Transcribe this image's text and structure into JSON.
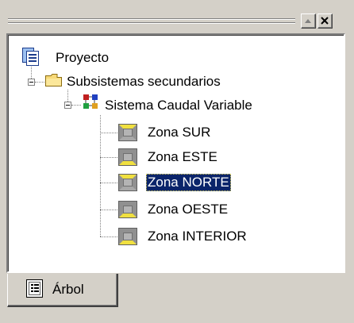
{
  "window": {
    "controls": [
      {
        "name": "scroll-up-arrow-icon"
      },
      {
        "name": "close-icon"
      }
    ]
  },
  "tree": {
    "root": {
      "label": "Proyecto",
      "icon": "project-icon"
    },
    "group": {
      "label": "Subsistemas secundarios",
      "icon": "folder-icon",
      "expanded": true
    },
    "system": {
      "label": "Sistema Caudal Variable",
      "icon": "system-icon",
      "expanded": true
    },
    "zones": [
      {
        "label": "Zona SUR",
        "icon": "zone-icon",
        "selected": false
      },
      {
        "label": "Zona ESTE",
        "icon": "zone-icon",
        "selected": false
      },
      {
        "label": "Zona NORTE",
        "icon": "zone-icon",
        "selected": true
      },
      {
        "label": "Zona OESTE",
        "icon": "zone-icon",
        "selected": false
      },
      {
        "label": "Zona INTERIOR",
        "icon": "zone-icon",
        "selected": false
      }
    ]
  },
  "tabs": [
    {
      "label": "Árbol",
      "icon": "tree-view-icon",
      "active": true
    }
  ],
  "colors": {
    "face": "#d4d0c8",
    "selection": "#0a246a",
    "zone_fill": "#f0e040",
    "zone_frame": "#909090"
  }
}
